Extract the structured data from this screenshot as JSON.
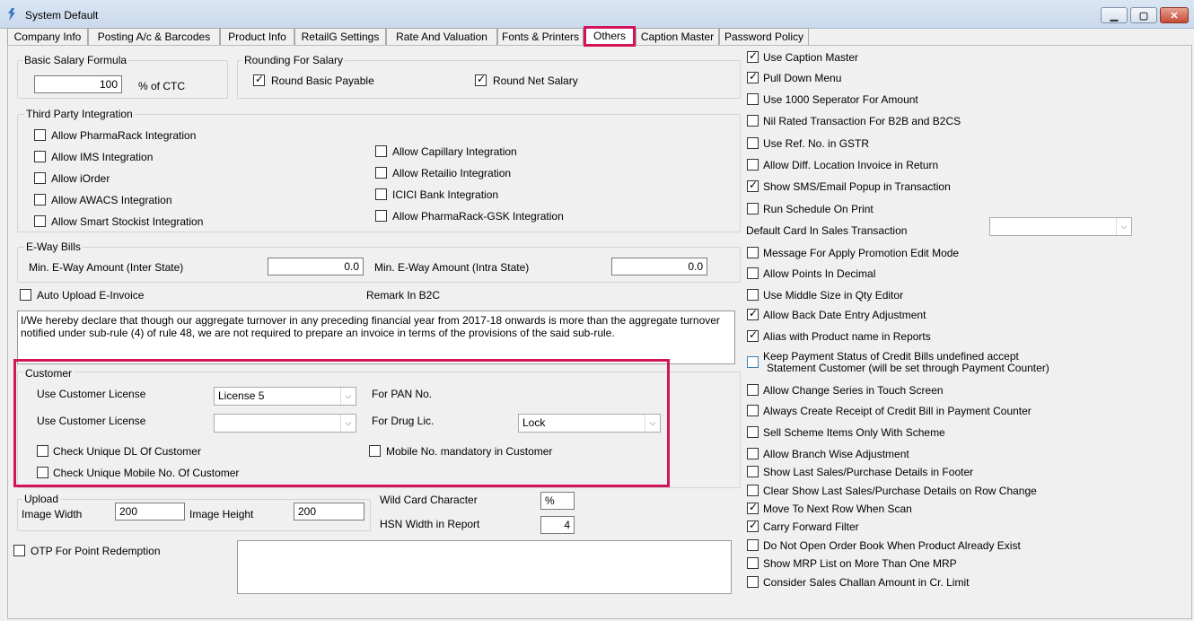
{
  "window": {
    "title": "System Default"
  },
  "tabs": [
    "Company Info",
    "Posting A/c & Barcodes",
    "Product Info",
    "RetailG Settings",
    "Rate And Valuation",
    "Fonts & Printers",
    "Others",
    "Caption Master",
    "Password Policy"
  ],
  "salary": {
    "group": "Basic Salary Formula",
    "value": "100",
    "unit": "% of CTC"
  },
  "rounding": {
    "group": "Rounding For Salary",
    "basic": "Round Basic Payable",
    "net": "Round Net Salary"
  },
  "third_party": {
    "group": "Third Party Integration",
    "left": [
      "Allow PharmaRack Integration",
      "Allow IMS Integration",
      "Allow iOrder",
      "Allow AWACS Integration",
      "Allow Smart Stockist Integration"
    ],
    "right": [
      "Allow Capillary Integration",
      "Allow Retailio Integration",
      "ICICI Bank Integration",
      "Allow PharmaRack-GSK Integration"
    ]
  },
  "eway": {
    "group": "E-Way Bills",
    "inter_label": "Min. E-Way Amount (Inter State)",
    "inter_value": "0.0",
    "intra_label": "Min. E-Way Amount (Intra State)",
    "intra_value": "0.0"
  },
  "einvoice": {
    "auto_upload": "Auto Upload E-Invoice",
    "remark_label": "Remark In B2C",
    "remark_text": "I/We hereby declare that though our aggregate turnover in any preceding financial year from 2017-18 onwards is more than the aggregate turnover notified under sub-rule (4) of rule 48, we are not required to prepare an invoice in terms of the provisions of the said sub-rule."
  },
  "customer": {
    "group": "Customer",
    "license_label_1": "Use Customer License",
    "license_value_1": "License 5",
    "pan_label": "For PAN No.",
    "license_label_2": "Use Customer License",
    "license_value_2": "",
    "drug_label": "For Drug Lic.",
    "drug_value": "Lock",
    "check_dl": "Check Unique DL Of Customer",
    "mobile_mandatory": "Mobile No. mandatory in Customer",
    "check_mobile": "Check Unique Mobile No. Of Customer"
  },
  "upload": {
    "group": "Upload",
    "width_label": "Image Width",
    "width_value": "200",
    "height_label": "Image Height",
    "height_value": "200"
  },
  "wildcard": {
    "label": "Wild Card Character",
    "value": "%"
  },
  "hsn": {
    "label": "HSN Width in Report",
    "value": "4"
  },
  "otp": {
    "label": "OTP For Point Redemption",
    "text": ""
  },
  "right_options": [
    {
      "label": "Use Caption Master",
      "checked": true
    },
    {
      "label": "Pull Down Menu",
      "checked": true
    },
    {
      "label": "Use 1000 Seperator For Amount",
      "checked": false
    },
    {
      "label": "Nil Rated Transaction For B2B and B2CS",
      "checked": false
    },
    {
      "label": "Use Ref. No. in GSTR",
      "checked": false
    },
    {
      "label": "Allow Diff. Location Invoice in Return",
      "checked": false
    },
    {
      "label": "Show SMS/Email Popup in Transaction",
      "checked": true
    },
    {
      "label": "Run Schedule On Print",
      "checked": false
    }
  ],
  "default_card": {
    "label": "Default Card In Sales Transaction",
    "value": ""
  },
  "right_options_2": [
    {
      "label": "Message For Apply Promotion Edit Mode",
      "checked": false
    },
    {
      "label": "Allow Points In Decimal",
      "checked": false
    },
    {
      "label": "Use Middle Size in Qty Editor",
      "checked": false
    },
    {
      "label": "Allow Back Date Entry Adjustment",
      "checked": true
    },
    {
      "label": "Alias with Product name in Reports",
      "checked": true
    }
  ],
  "keep_payment": {
    "line1": "Keep Payment Status of Credit Bills undefined accept",
    "line2": "Statement Customer (will be set through Payment Counter)"
  },
  "right_options_3": [
    {
      "label": "Allow Change Series in Touch Screen",
      "checked": false
    },
    {
      "label": "Always Create Receipt of Credit Bill in Payment Counter",
      "checked": false
    },
    {
      "label": "Sell Scheme Items Only With Scheme",
      "checked": false
    },
    {
      "label": "Allow Branch Wise Adjustment",
      "checked": false
    },
    {
      "label": "Show Last Sales/Purchase Details in Footer",
      "checked": false
    },
    {
      "label": "Clear Show Last Sales/Purchase Details on Row Change",
      "checked": false
    },
    {
      "label": "Move To Next Row When Scan",
      "checked": true
    },
    {
      "label": "Carry Forward Filter",
      "checked": true
    },
    {
      "label": "Do Not Open Order Book When Product Already Exist",
      "checked": false
    },
    {
      "label": "Show MRP List on More Than One MRP",
      "checked": false
    },
    {
      "label": "Consider Sales Challan Amount in Cr. Limit",
      "checked": false
    }
  ],
  "colors": {
    "highlight": "#d4145a"
  }
}
